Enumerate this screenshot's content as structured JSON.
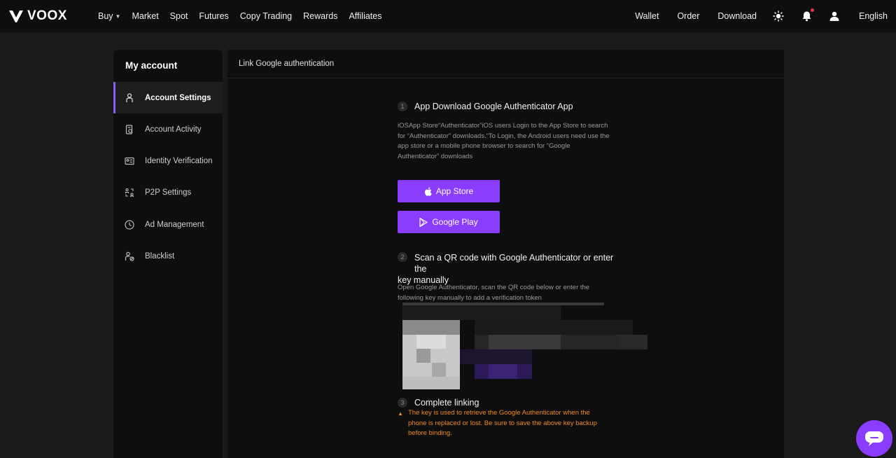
{
  "brand": {
    "name": "VOOX"
  },
  "nav": {
    "left": [
      {
        "label": "Buy",
        "has_caret": true
      },
      {
        "label": "Market"
      },
      {
        "label": "Spot"
      },
      {
        "label": "Futures"
      },
      {
        "label": "Copy Trading"
      },
      {
        "label": "Rewards"
      },
      {
        "label": "Affiliates"
      }
    ],
    "right": {
      "wallet": "Wallet",
      "order": "Order",
      "download": "Download",
      "language": "English"
    },
    "icons": [
      "sun-icon",
      "bell-icon",
      "user-icon"
    ]
  },
  "sidebar": {
    "title": "My account",
    "items": [
      {
        "label": "Account Settings",
        "icon": "person-icon",
        "active": true
      },
      {
        "label": "Account Activity",
        "icon": "activity-icon"
      },
      {
        "label": "Identity Verification",
        "icon": "id-card-icon"
      },
      {
        "label": "P2P Settings",
        "icon": "p2p-icon"
      },
      {
        "label": "Ad Management",
        "icon": "clock-icon"
      },
      {
        "label": "Blacklist",
        "icon": "user-block-icon"
      }
    ]
  },
  "main": {
    "title": "Link Google authentication",
    "step1": {
      "num": "1",
      "title": "App Download Google Authenticator App",
      "desc_lines": [
        "iOSApp Store“Authenticator”iOS users Login to the App Store to search",
        "for “Authenticator” downloads.“To Login, the Android users need use the",
        "app store or a mobile phone browser to search for “Google",
        "Authenticator” downloads"
      ],
      "app_store_label": "App Store",
      "google_play_label": "Google Play"
    },
    "step2": {
      "num": "2",
      "title_lines": [
        "Scan a QR code with Google Authenticator or enter the",
        "key manually"
      ],
      "desc_lines": [
        "Open Google Authenticator, scan the QR code below or enter the",
        "following key manually to add a verification token"
      ]
    },
    "step3": {
      "num": "3",
      "title": "Complete linking",
      "warning_lines": [
        "The key is used to retrieve the Google Authenticator when the",
        "phone is replaced or lost. Be sure to save the above key backup",
        "before binding."
      ]
    }
  },
  "colors": {
    "accent": "#8b3dff",
    "warning": "#f08a24",
    "notification": "#e0393e"
  }
}
